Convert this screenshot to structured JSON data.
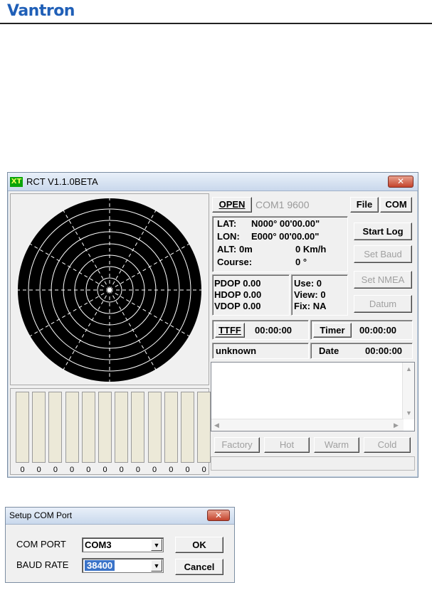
{
  "header": {
    "brand": "Vantron"
  },
  "main_window": {
    "title": "RCT V1.1.0BETA",
    "app_icon_text": "XT",
    "close_label": "✕",
    "toolbar": {
      "open_label": "OPEN",
      "port_status": "COM1 9600",
      "file_label": "File",
      "com_label": "COM"
    },
    "position": {
      "lat_label": "LAT:",
      "lat_value": "N000° 00'00.00\"",
      "lon_label": "LON:",
      "lon_value": "E000° 00'00.00\"",
      "alt_label": "ALT:",
      "alt_value": "0m",
      "speed_value": "0 Km/h",
      "course_label": "Course:",
      "course_value": "0 °"
    },
    "dop": {
      "pdop": "PDOP 0.00",
      "hdop": "HDOP 0.00",
      "vdop": "VDOP 0.00"
    },
    "sats": {
      "use": "Use:  0",
      "view": "View: 0",
      "fix": "Fix: NA"
    },
    "side_buttons": {
      "start_log": "Start Log",
      "set_baud": "Set Baud",
      "set_nmea": "Set NMEA",
      "datum": "Datum"
    },
    "ttff_label": "TTFF",
    "ttff_value": "00:00:00",
    "timer_label": "Timer",
    "timer_value": "00:00:00",
    "status_text": "unknown",
    "date_label": "Date",
    "date_value": "00:00:00",
    "restart_buttons": {
      "factory": "Factory",
      "hot": "Hot",
      "warm": "Warm",
      "cold": "Cold"
    },
    "signal_values": [
      "0",
      "0",
      "0",
      "0",
      "0",
      "0",
      "0",
      "0",
      "0",
      "0",
      "0",
      "0"
    ]
  },
  "com_dialog": {
    "title": "Setup COM Port",
    "close_label": "✕",
    "com_port_label": "COM PORT",
    "com_port_value": "COM3",
    "baud_rate_label": "BAUD RATE",
    "baud_rate_value": "38400",
    "ok_label": "OK",
    "cancel_label": "Cancel"
  }
}
